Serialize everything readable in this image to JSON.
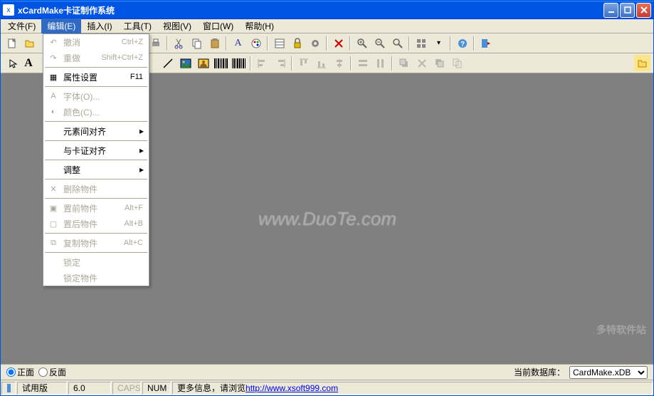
{
  "titlebar": {
    "title": "xCardMake卡证制作系统"
  },
  "menubar": {
    "file": "文件(F)",
    "edit": "编辑(E)",
    "insert": "插入(I)",
    "tool": "工具(T)",
    "view": "视图(V)",
    "window": "窗口(W)",
    "help": "帮助(H)"
  },
  "edit_menu": {
    "undo": "撤消",
    "undo_sc": "Ctrl+Z",
    "redo": "重做",
    "redo_sc": "Shift+Ctrl+Z",
    "props": "属性设置",
    "props_sc": "F11",
    "font": "字体(O)...",
    "color": "颜色(C)...",
    "align_elements": "元素间对齐",
    "align_card": "与卡证对齐",
    "adjust": "调整",
    "delete": "删除物件",
    "front": "置前物件",
    "front_sc": "Alt+F",
    "back": "置后物件",
    "back_sc": "Alt+B",
    "copy": "复制物件",
    "copy_sc": "Alt+C",
    "lock": "锁定",
    "lock_obj": "锁定物件"
  },
  "radiobar": {
    "front": "正面",
    "back": "反面",
    "db_label": "当前数据库：",
    "db_value": "CardMake.xDB"
  },
  "statusbar": {
    "trial": "试用版",
    "version": "6.0",
    "caps": "CAPS",
    "num": "NUM",
    "more_info": "更多信息，请浏览",
    "url": "http://www.xsoft999.com"
  },
  "watermark": "www.DuoTe.com",
  "bottom_watermark": "多特软件站"
}
